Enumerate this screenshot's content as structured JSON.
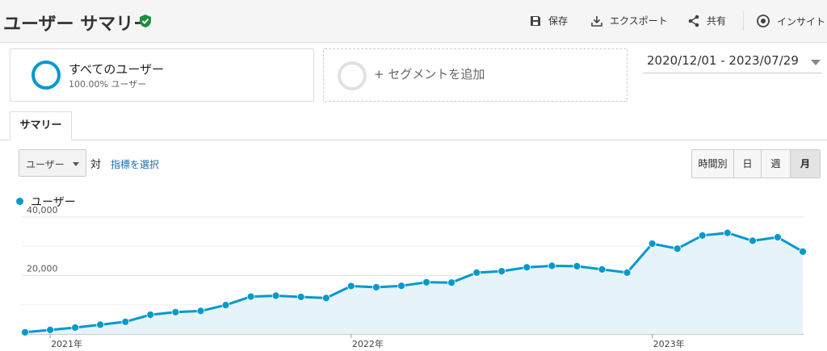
{
  "header": {
    "title": "ユーザー サマリー",
    "actions": {
      "save": "保存",
      "export": "エクスポート",
      "share": "共有",
      "insights": "インサイト"
    }
  },
  "segments": {
    "all_users_title": "すべてのユーザー",
    "all_users_sub": "100.00% ユーザー",
    "add_segment": "+ セグメントを追加"
  },
  "date_range": "2020/12/01 - 2023/07/29",
  "tabs": {
    "summary": "サマリー"
  },
  "controls": {
    "metric": "ユーザー",
    "versus": "対",
    "pick_metric": "指標を選択",
    "granularity": [
      "時間別",
      "日",
      "週",
      "月"
    ],
    "granularity_active": "月"
  },
  "legend": {
    "series_label": "ユーザー"
  },
  "colors": {
    "accent": "#0099cc",
    "fill": "#e6f4fa",
    "verified": "#1e8e3e"
  },
  "chart_data": {
    "type": "area",
    "x": [
      "2020-12",
      "2021-01",
      "2021-02",
      "2021-03",
      "2021-04",
      "2021-05",
      "2021-06",
      "2021-07",
      "2021-08",
      "2021-09",
      "2021-10",
      "2021-11",
      "2021-12",
      "2022-01",
      "2022-02",
      "2022-03",
      "2022-04",
      "2022-05",
      "2022-06",
      "2022-07",
      "2022-08",
      "2022-09",
      "2022-10",
      "2022-11",
      "2022-12",
      "2023-01",
      "2023-02",
      "2023-03",
      "2023-04",
      "2023-05",
      "2023-06",
      "2023-07"
    ],
    "series": [
      {
        "name": "ユーザー",
        "values": [
          600,
          1400,
          2200,
          3200,
          4200,
          6600,
          7500,
          7900,
          9900,
          12800,
          13100,
          12700,
          12300,
          16400,
          16000,
          16500,
          17700,
          17600,
          21000,
          21500,
          22800,
          23300,
          23200,
          22100,
          21000,
          30900,
          29200,
          33700,
          34600,
          31900,
          33100,
          28200
        ]
      }
    ],
    "yticks": [
      "20,000",
      "40,000"
    ],
    "ytick_values": [
      20000,
      40000
    ],
    "xticks": [
      "2021年",
      "2022年",
      "2023年"
    ],
    "xtick_index": [
      1,
      13,
      25
    ],
    "ylim": [
      0,
      40000
    ]
  }
}
